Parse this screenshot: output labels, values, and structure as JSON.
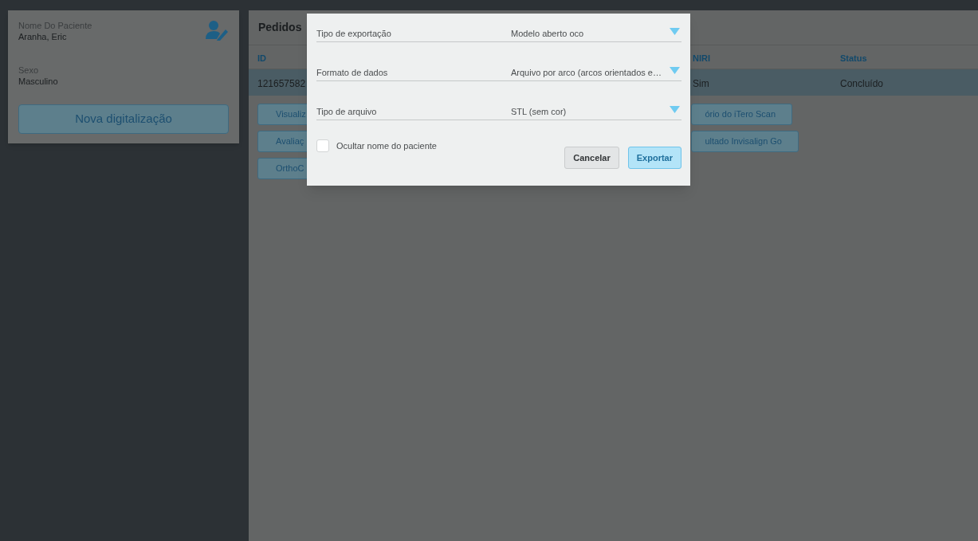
{
  "patient_card": {
    "fields": [
      {
        "label": "Nome Do Paciente",
        "value": "Aranha, Eric"
      },
      {
        "label": "Sexo",
        "value": "Masculino"
      }
    ],
    "new_scan_button": "Nova digitalização"
  },
  "orders": {
    "title": "Pedidos",
    "columns": [
      "ID",
      "NIRI",
      "Status"
    ],
    "rows": [
      {
        "cells": [
          "121657582",
          "Sim",
          "Concluído"
        ],
        "selected": true
      }
    ],
    "left_buttons": [
      "Visualiz",
      "Avaliaç",
      "OrthoC"
    ],
    "right_buttons": [
      "ório do iTero Scan",
      "ultado Invisalign Go"
    ]
  },
  "export_dialog": {
    "fields": [
      {
        "label": "Tipo de exportação",
        "value": "Modelo aberto oco"
      },
      {
        "label": "Formato de dados",
        "value": "Arquivo por arco (arcos orientados e…"
      },
      {
        "label": "Tipo de arquivo",
        "value": "STL (sem cor)"
      }
    ],
    "hide_name_checkbox": {
      "label": "Ocultar nome do paciente",
      "checked": false
    },
    "buttons": [
      {
        "label": "Cancelar",
        "kind": "secondary"
      },
      {
        "label": "Exportar",
        "kind": "primary"
      }
    ]
  }
}
